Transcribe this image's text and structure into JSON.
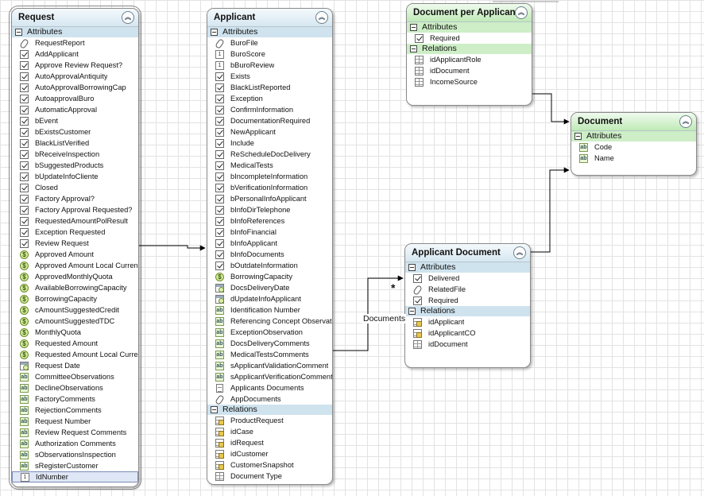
{
  "entities": {
    "request": {
      "title": "Request",
      "attributes_label": "Attributes",
      "attributes": [
        {
          "label": "RequestReport",
          "icon": "paperclip-icon"
        },
        {
          "label": "AddApplicant",
          "icon": "checkbox-icon"
        },
        {
          "label": "Approve Review Request?",
          "icon": "checkbox-icon"
        },
        {
          "label": "AutoApprovalAntiquity",
          "icon": "checkbox-icon"
        },
        {
          "label": "AutoApprovalBorrowingCap",
          "icon": "checkbox-icon"
        },
        {
          "label": "AutoapprovalBuro",
          "icon": "checkbox-icon"
        },
        {
          "label": "AutomaticApproval",
          "icon": "checkbox-icon"
        },
        {
          "label": "bEvent",
          "icon": "checkbox-icon"
        },
        {
          "label": "bExistsCustomer",
          "icon": "checkbox-icon"
        },
        {
          "label": "BlackListVerified",
          "icon": "checkbox-icon"
        },
        {
          "label": "bReceiveInspection",
          "icon": "checkbox-icon"
        },
        {
          "label": "bSuggestedProducts",
          "icon": "checkbox-icon"
        },
        {
          "label": "bUpdateInfoCliente",
          "icon": "checkbox-icon"
        },
        {
          "label": "Closed",
          "icon": "checkbox-icon"
        },
        {
          "label": "Factory Approval?",
          "icon": "checkbox-icon"
        },
        {
          "label": "Factory Approval Requested?",
          "icon": "checkbox-icon"
        },
        {
          "label": "RequestedAmountPolResult",
          "icon": "checkbox-icon"
        },
        {
          "label": "Exception Requested",
          "icon": "checkbox-icon"
        },
        {
          "label": "Review Request",
          "icon": "checkbox-icon"
        },
        {
          "label": "Approved Amount",
          "icon": "currency-icon"
        },
        {
          "label": "Approved Amount Local Currency",
          "icon": "currency-icon"
        },
        {
          "label": "ApprovedMonthlyQuota",
          "icon": "currency-icon"
        },
        {
          "label": "AvailableBorrowingCapacity",
          "icon": "currency-icon"
        },
        {
          "label": "BorrowingCapacity",
          "icon": "currency-icon"
        },
        {
          "label": "cAmountSuggestedCredit",
          "icon": "currency-icon"
        },
        {
          "label": "cAmountSuggestedTDC",
          "icon": "currency-icon"
        },
        {
          "label": "MonthlyQuota",
          "icon": "currency-icon"
        },
        {
          "label": "Requested Amount",
          "icon": "currency-icon"
        },
        {
          "label": "Requested Amount Local Currency",
          "icon": "currency-icon"
        },
        {
          "label": "Request Date",
          "icon": "date-icon"
        },
        {
          "label": "CommitteeObservations",
          "icon": "text-icon"
        },
        {
          "label": "DeclineObservations",
          "icon": "text-icon"
        },
        {
          "label": "FactoryComments",
          "icon": "text-icon"
        },
        {
          "label": "RejectionComments",
          "icon": "text-icon"
        },
        {
          "label": "Request Number",
          "icon": "text-icon"
        },
        {
          "label": "Review Request Comments",
          "icon": "text-icon"
        },
        {
          "label": "Authorization Comments",
          "icon": "text-icon"
        },
        {
          "label": "sObservationsInspection",
          "icon": "text-icon"
        },
        {
          "label": "sRegisterCustomer",
          "icon": "text-icon"
        },
        {
          "label": "IdNumber",
          "icon": "number-icon",
          "selected": true
        }
      ]
    },
    "applicant": {
      "title": "Applicant",
      "attributes_label": "Attributes",
      "attributes": [
        {
          "label": "BuroFile",
          "icon": "paperclip-icon"
        },
        {
          "label": "BuroScore",
          "icon": "number-icon"
        },
        {
          "label": "bBuroReview",
          "icon": "number-icon"
        },
        {
          "label": "Exists",
          "icon": "checkbox-icon"
        },
        {
          "label": "BlackListReported",
          "icon": "checkbox-icon"
        },
        {
          "label": "Exception",
          "icon": "checkbox-icon"
        },
        {
          "label": "ConfirmInformation",
          "icon": "checkbox-icon"
        },
        {
          "label": "DocumentationRequired",
          "icon": "checkbox-icon"
        },
        {
          "label": "NewApplicant",
          "icon": "checkbox-icon"
        },
        {
          "label": "Include",
          "icon": "checkbox-icon"
        },
        {
          "label": "ReScheduleDocDelivery",
          "icon": "checkbox-icon"
        },
        {
          "label": "MedicalTests",
          "icon": "checkbox-icon"
        },
        {
          "label": "bIncompleteInformation",
          "icon": "checkbox-icon"
        },
        {
          "label": "bVerificationInformation",
          "icon": "checkbox-icon"
        },
        {
          "label": "bPersonalInfoApplicant",
          "icon": "checkbox-icon"
        },
        {
          "label": "bInfoDirTelephone",
          "icon": "checkbox-icon"
        },
        {
          "label": "bInfoReferences",
          "icon": "checkbox-icon"
        },
        {
          "label": "bInfoFinancial",
          "icon": "checkbox-icon"
        },
        {
          "label": "bInfoApplicant",
          "icon": "checkbox-icon"
        },
        {
          "label": "bInfoDocuments",
          "icon": "checkbox-icon"
        },
        {
          "label": "bOutdateInformation",
          "icon": "checkbox-icon"
        },
        {
          "label": "BorrowingCapacity",
          "icon": "currency-icon"
        },
        {
          "label": "DocsDeliveryDate",
          "icon": "date-icon"
        },
        {
          "label": "dUpdateInfoApplicant",
          "icon": "date-icon"
        },
        {
          "label": "Identification Number",
          "icon": "text-icon"
        },
        {
          "label": "Referencing Concept Observations",
          "icon": "text-icon"
        },
        {
          "label": "ExceptionObservation",
          "icon": "text-icon"
        },
        {
          "label": "DocsDeliveryComments",
          "icon": "text-icon"
        },
        {
          "label": "MedicalTestsComments",
          "icon": "text-icon"
        },
        {
          "label": "sApplicantValidationComment",
          "icon": "text-icon"
        },
        {
          "label": "sApplicantVerificationComment",
          "icon": "text-icon"
        },
        {
          "label": "Applicants Documents",
          "icon": "file-icon"
        },
        {
          "label": "AppDocuments",
          "icon": "paperclip-icon"
        }
      ],
      "relations_label": "Relations",
      "relations": [
        {
          "label": "ProductRequest",
          "icon": "multi-table-icon"
        },
        {
          "label": "idCase",
          "icon": "multi-table-icon"
        },
        {
          "label": "idRequest",
          "icon": "multi-table-icon"
        },
        {
          "label": "idCustomer",
          "icon": "multi-table-icon"
        },
        {
          "label": "CustomerSnapshot",
          "icon": "multi-table-icon"
        },
        {
          "label": "Document Type",
          "icon": "table-icon"
        }
      ]
    },
    "document_per_applicant": {
      "title": "Document per Applicant",
      "attributes_label": "Attributes",
      "attributes": [
        {
          "label": "Required",
          "icon": "checkbox-icon"
        }
      ],
      "relations_label": "Relations",
      "relations": [
        {
          "label": "idApplicantRole",
          "icon": "table-icon"
        },
        {
          "label": "idDocument",
          "icon": "table-icon"
        },
        {
          "label": "IncomeSource",
          "icon": "table-icon"
        }
      ]
    },
    "document": {
      "title": "Document",
      "attributes_label": "Attributes",
      "attributes": [
        {
          "label": "Code",
          "icon": "text-icon"
        },
        {
          "label": "Name",
          "icon": "text-icon"
        }
      ]
    },
    "applicant_document": {
      "title": "Applicant Document",
      "attributes_label": "Attributes",
      "attributes": [
        {
          "label": "Delivered",
          "icon": "checkbox-icon"
        },
        {
          "label": "RelatedFile",
          "icon": "paperclip-icon"
        },
        {
          "label": "Required",
          "icon": "checkbox-icon"
        }
      ],
      "relations_label": "Relations",
      "relations": [
        {
          "label": "idApplicant",
          "icon": "multi-table-icon"
        },
        {
          "label": "idApplicantCO",
          "icon": "multi-table-icon"
        },
        {
          "label": "idDocument",
          "icon": "table-icon"
        }
      ]
    }
  },
  "connectors": {
    "applicant_to_applicant_document_label": "Documents",
    "applicant_to_applicant_document_multiplicity": "*"
  },
  "colors": {
    "header_blue": "#d6e7f1",
    "header_green": "#bfeab6",
    "connector": "#000000"
  }
}
